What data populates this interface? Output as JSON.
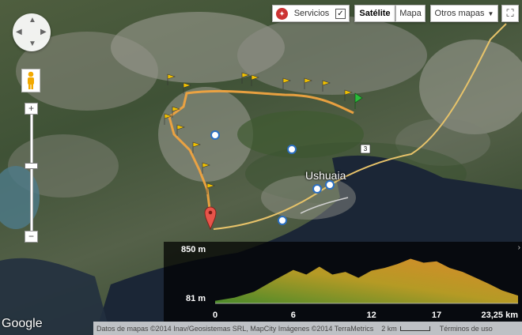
{
  "controls": {
    "servicios_label": "Servicios",
    "servicios_checked": "✓",
    "satellite_label": "Satélite",
    "map_label": "Mapa",
    "other_maps_label": "Otros mapas",
    "other_maps_arrow": "▼",
    "fullscreen_icon": "⛶"
  },
  "zoom": {
    "plus": "+",
    "minus": "−"
  },
  "map": {
    "city_label": "Ushuaia",
    "road_number": "3"
  },
  "elevation": {
    "max_label": "850 m",
    "min_label": "81 m",
    "chart_data": {
      "type": "area",
      "x_ticks": [
        "0",
        "6",
        "12",
        "17",
        "23,25 km"
      ],
      "ylim": [
        81,
        850
      ],
      "x": [
        0,
        1.5,
        3,
        4.5,
        6,
        7,
        8,
        9,
        10,
        11,
        12,
        13,
        14,
        15,
        16,
        17,
        18,
        19,
        20,
        21,
        22,
        23.25
      ],
      "y": [
        120,
        170,
        260,
        430,
        590,
        520,
        640,
        520,
        560,
        470,
        580,
        620,
        680,
        760,
        700,
        720,
        620,
        560,
        470,
        380,
        280,
        200
      ]
    }
  },
  "footer": {
    "attribution": "Datos de mapas ©2014 Inav/Geosistemas SRL, MapCity Imágenes ©2014 TerraMetrics",
    "scale": "2 km",
    "terms": "Términos de uso"
  },
  "logo": "Google"
}
